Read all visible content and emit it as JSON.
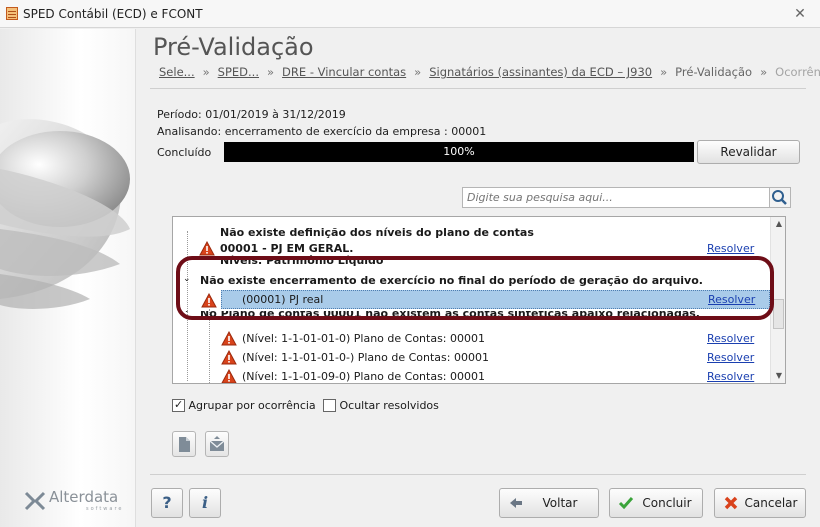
{
  "window": {
    "title": "SPED Contábil (ECD) e FCONT",
    "close_glyph": "✕"
  },
  "brand": {
    "name": "Alterdata",
    "sub": "software"
  },
  "page": {
    "title": "Pré-Validação"
  },
  "breadcrumb": [
    {
      "label": "Sele..."
    },
    {
      "label": "SPED..."
    },
    {
      "label": "DRE - Vincular contas"
    },
    {
      "label": "Signatários (assinantes) da ECD – J930"
    },
    {
      "label": "Pré-Validação"
    },
    {
      "label": "Ocorrências"
    }
  ],
  "breadcrumb_sep": "»",
  "info": {
    "periodo": "Período: 01/01/2019 à 31/12/2019",
    "analisando": "Analisando: encerramento de exercício da empresa : 00001",
    "concluido_label": "Concluído",
    "progress_text": "100%",
    "progress_value": 1.0
  },
  "buttons": {
    "revalidar": "Revalidar",
    "voltar": "Voltar",
    "concluir": "Concluir",
    "cancelar": "Cancelar",
    "help": "?",
    "info": "i"
  },
  "search": {
    "placeholder": "Digite sua pesquisa aqui..."
  },
  "list": {
    "group1_header": "Não existe definição dos níveis do plano de contas",
    "group1_item": "00001 - PJ EM GERAL.",
    "group1_sub": "Níveis: Patrimônio Líquido",
    "group2_toggle": "⌄",
    "group2_header": "Não existe encerramento de exercício no final do período de geração do arquivo.",
    "group2_item": "(00001) PJ real",
    "group3_toggle": "⌄",
    "group3_header": "No Plano de contas 00001 não existem as contas sintéticas abaixo relacionadas.",
    "group3_items": [
      "(Nível: 1-1-01-01-0) Plano de Contas: 00001",
      "(Nível: 1-1-01-01-0-) Plano de Contas: 00001",
      "(Nível: 1-1-01-09-0) Plano de Contas: 00001"
    ],
    "resolve_label": "Resolver"
  },
  "options": {
    "agrupar": {
      "label": "Agrupar por ocorrência",
      "checked": true
    },
    "ocultar": {
      "label": "Ocultar resolvidos",
      "checked": false
    }
  },
  "colors": {
    "highlight_ring": "#6e0d17",
    "selection": "#a9cbe9",
    "link": "#1a3fb0",
    "progress": "#000000"
  }
}
